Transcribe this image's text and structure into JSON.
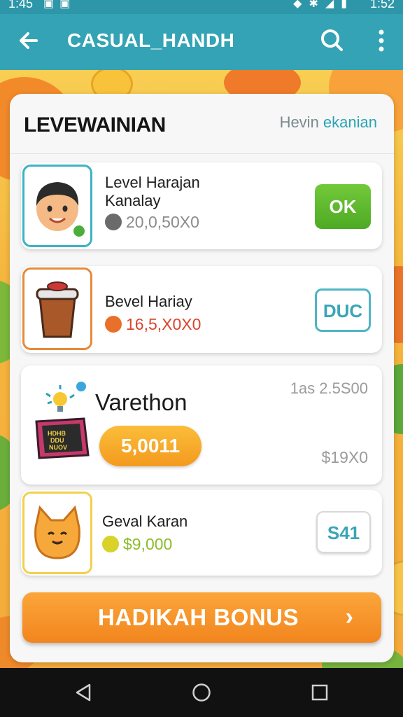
{
  "status_bar": {
    "time_left": "1:45",
    "time_right": "1:52"
  },
  "app_bar": {
    "title": "CASUAL_HANDH"
  },
  "card": {
    "title": "LEVEWAINIAN",
    "link_prefix": "Hevin ",
    "link_accent": "ekanian"
  },
  "items": [
    {
      "name_line1": "Level Harajan",
      "name_line2": "Kanalay",
      "price": "20,0,50X0",
      "button": "OK"
    },
    {
      "name_line1": "Bevel Hariay",
      "price": "16,5,X0X0",
      "button": "DUC"
    },
    {
      "name": "Varethon",
      "badge": "5,0011",
      "top_right": "1as 2.5S00",
      "bottom_right": "$19X0",
      "sign_text": "HDHB DDU NUOV"
    },
    {
      "name_line1": "Geval Karan",
      "price": "$9,000",
      "button": "S41"
    }
  ],
  "bonus": {
    "label": "HADIKAH BONUS",
    "arrow": "›"
  },
  "colors": {
    "appbar": "#33a3b5",
    "ok_green": "#5cba2e",
    "bonus_orange": "#f2851e",
    "price_red": "#d9452c",
    "price_green": "#8cbc2c"
  }
}
